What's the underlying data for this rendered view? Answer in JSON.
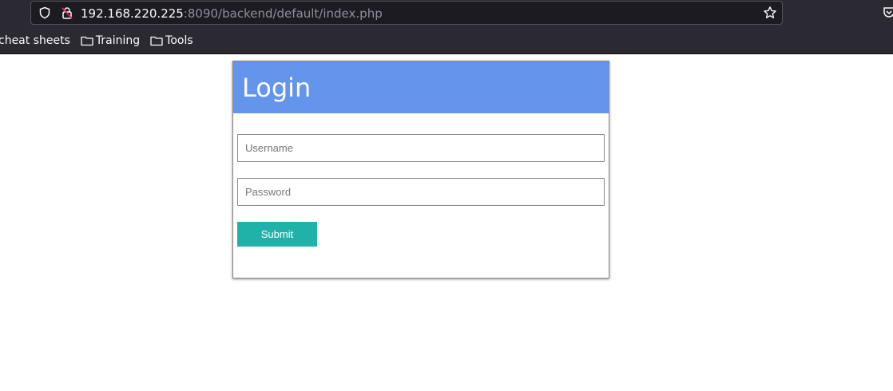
{
  "browser": {
    "url_host": "192.168.220.225",
    "url_rest": ":8090/backend/default/index.php",
    "icons": {
      "tracking": "shield-icon",
      "security": "lock-slash-icon",
      "bookmark": "star-icon"
    },
    "bookmarks": [
      {
        "label": "cheat sheets",
        "icon": ""
      },
      {
        "label": "Training",
        "icon": "folder-icon"
      },
      {
        "label": "Tools",
        "icon": "folder-icon"
      }
    ]
  },
  "login": {
    "title": "Login",
    "username_placeholder": "Username",
    "password_placeholder": "Password",
    "submit_label": "Submit"
  },
  "colors": {
    "header": "#6495ed",
    "submit": "#20b2aa"
  }
}
